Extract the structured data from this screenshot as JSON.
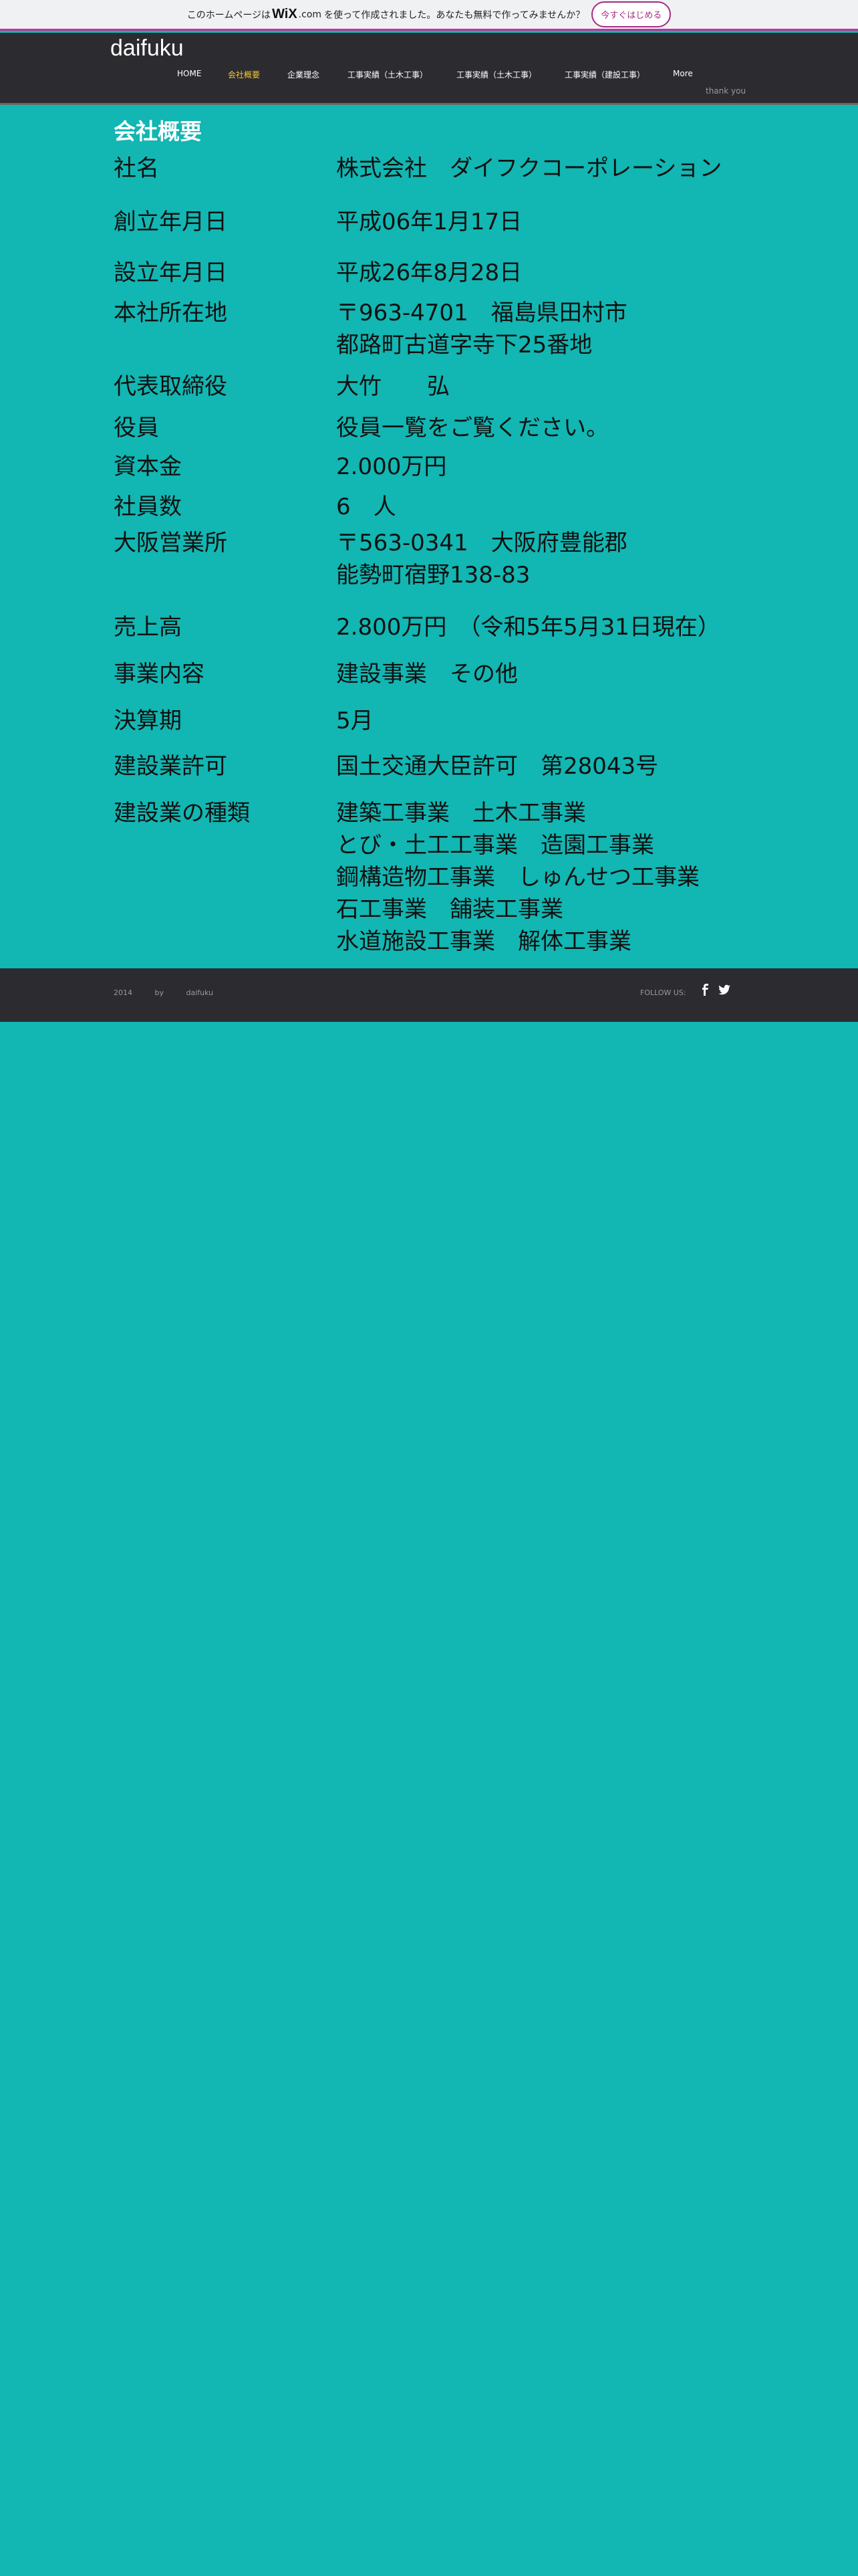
{
  "banner": {
    "text_before": "このホームページは",
    "wix_logo": "WiX",
    "wix_com": ".com",
    "text_after": "を使って作成されました。あなたも無料で作ってみませんか？",
    "button": "今すぐはじめる",
    "accent_color": "#c2329b"
  },
  "header": {
    "logo": "daifuku",
    "nav": [
      {
        "label": "HOME"
      },
      {
        "label": "会社概要",
        "active": true
      },
      {
        "label": "企業理念"
      },
      {
        "label": "工事実績（土木工事）"
      },
      {
        "label": "工事実績（土木工事）"
      },
      {
        "label": "工事実績（建設工事）"
      },
      {
        "label": "More"
      }
    ],
    "sub": "thank you"
  },
  "content": {
    "title": "会社概要",
    "rows": [
      {
        "label": "社名",
        "value": [
          "株式会社　ダイフクコーポレーション"
        ]
      },
      {
        "label": "創立年月日",
        "value": [
          "平成06年1月17日"
        ]
      },
      {
        "label": "設立年月日",
        "value": [
          "平成26年8月28日"
        ]
      },
      {
        "label": "本社所在地",
        "value": [
          "〒963-4701　福島県田村市",
          "都路町古道字寺下25番地"
        ]
      },
      {
        "label": "代表取締役",
        "value": [
          "大竹　　弘"
        ]
      },
      {
        "label": "役員",
        "value": [
          "役員一覧をご覧ください。"
        ]
      },
      {
        "label": "資本金",
        "value": [
          "2.000万円"
        ]
      },
      {
        "label": "社員数",
        "value": [
          "6　人"
        ]
      },
      {
        "label": "大阪営業所",
        "value": [
          "〒563-0341　大阪府豊能郡",
          "能勢町宿野138-83"
        ]
      },
      {
        "label": "売上高",
        "value": [
          "2.800万円　（令和5年5月31日現在）"
        ]
      },
      {
        "label": "事業内容",
        "value": [
          "建設事業　その他"
        ]
      },
      {
        "label": "決算期",
        "value": [
          "5月"
        ]
      },
      {
        "label": "建設業許可",
        "value": [
          "国土交通大臣許可　第28043号"
        ]
      },
      {
        "label": "建設業の種類",
        "value": [
          "建築工事業　土木工事業",
          "とび・土工工事業　造園工事業",
          "鋼構造物工事業　しゅんせつ工事業",
          "石工事業　舗装工事業",
          "水道施設工事業　解体工事業"
        ]
      }
    ]
  },
  "footer": {
    "year": "2014",
    "by": "by",
    "name": "daifuku",
    "follow": "FOLLOW US:",
    "icons": [
      "facebook-icon",
      "twitter-icon"
    ]
  },
  "colors": {
    "background": "#12b6b2",
    "header": "#2c2b2f",
    "nav_active": "#f2c83a"
  }
}
